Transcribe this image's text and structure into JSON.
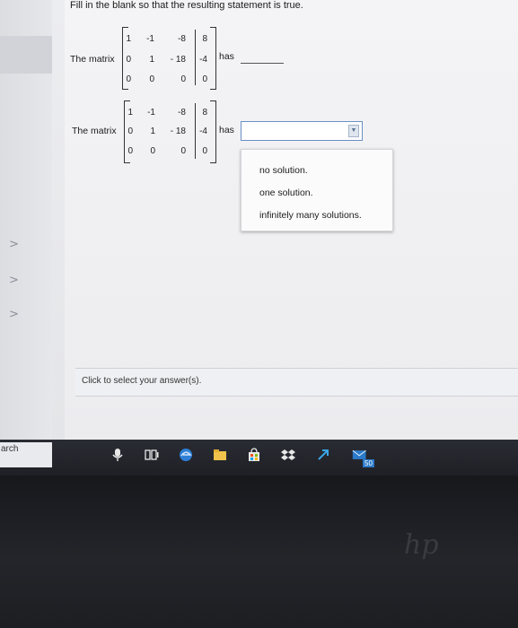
{
  "question": {
    "prompt": "Fill in the blank so that the resulting statement is true."
  },
  "statement1": {
    "prefix": "The matrix",
    "suffix": "has",
    "rows": [
      [
        "1",
        "-1",
        "-8",
        "8"
      ],
      [
        "0",
        "1",
        "- 18",
        "-4"
      ],
      [
        "0",
        "0",
        "0",
        "0"
      ]
    ]
  },
  "statement2": {
    "prefix": "The matrix",
    "suffix": "has",
    "rows": [
      [
        "1",
        "-1",
        "-8",
        "8"
      ],
      [
        "0",
        "1",
        "- 18",
        "-4"
      ],
      [
        "0",
        "0",
        "0",
        "0"
      ]
    ],
    "dropdown": {
      "selected": "",
      "options": [
        "no solution.",
        "one solution.",
        "infinitely many solutions."
      ]
    }
  },
  "hint": {
    "text": "Click to select your answer(s)."
  },
  "taskbar": {
    "search_fragment": "arch",
    "badge": "50",
    "icons": [
      "microphone-icon",
      "task-view-icon",
      "edge-browser-icon",
      "file-explorer-icon",
      "store-icon",
      "dropbox-icon",
      "app-arrow-icon",
      "mail-icon"
    ]
  },
  "rail": {
    "chevrons": [
      ">",
      ">",
      ">"
    ]
  },
  "colors": {
    "dropdown_border": "#6a8fc7",
    "taskbar": "#24262c"
  }
}
